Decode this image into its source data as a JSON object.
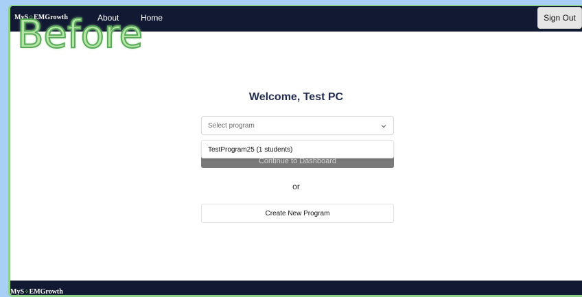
{
  "header": {
    "brand_prefix": "MyS",
    "brand_leaf": "⁘",
    "brand_suffix": "EMGrowth",
    "nav": [
      {
        "label": "About"
      },
      {
        "label": "Home"
      }
    ],
    "sign_out_label": "Sign Out"
  },
  "overlay": {
    "watermark_text": "Before"
  },
  "main": {
    "welcome_text": "Welcome, Test PC",
    "program_select": {
      "placeholder": "Select program",
      "options": [
        "TestProgram25 (1 students)"
      ]
    },
    "continue_label": "Continue to Dashboard",
    "or_text": "or",
    "create_label": "Create New Program"
  },
  "footer": {
    "brand_prefix": "MyS",
    "brand_leaf": "⁘",
    "brand_suffix": "EMGrowth"
  },
  "colors": {
    "nav_background": "#121a33",
    "page_background": "#a8cff5",
    "frame_border": "#8fd08a",
    "watermark_fill": "#b4e6a6",
    "brand_accent": "#6cc46a",
    "disabled_button": "#7a7a7a"
  }
}
